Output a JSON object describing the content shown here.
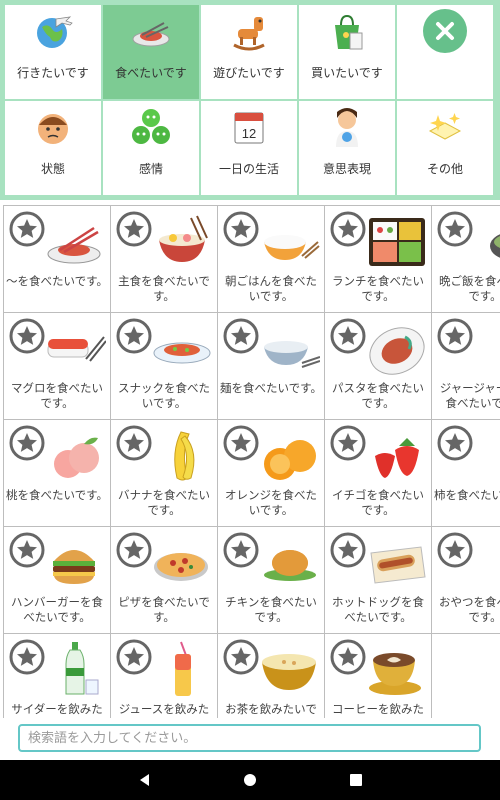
{
  "categories": [
    {
      "label": "行きたいです",
      "icon": "globe-airplane-icon",
      "selected": false
    },
    {
      "label": "食べたいです",
      "icon": "food-plate-icon",
      "selected": true
    },
    {
      "label": "遊びたいです",
      "icon": "rocking-horse-icon",
      "selected": false
    },
    {
      "label": "買いたいです",
      "icon": "shopping-bag-icon",
      "selected": false
    },
    {
      "label": "",
      "icon": "close-icon",
      "selected": false
    },
    {
      "label": "状態",
      "icon": "sick-face-icon",
      "selected": false
    },
    {
      "label": "感情",
      "icon": "emotion-faces-icon",
      "selected": false
    },
    {
      "label": "一日の生活",
      "icon": "calendar-icon",
      "selected": false
    },
    {
      "label": "意思表現",
      "icon": "mother-child-icon",
      "selected": false
    },
    {
      "label": "その他",
      "icon": "sparkle-box-icon",
      "selected": false
    }
  ],
  "calendar_number": "12",
  "items": [
    {
      "label": "～を食べたいです。",
      "icon": "meal-plate-icon"
    },
    {
      "label": "主食を食べたいです。",
      "icon": "rice-bowl-icon"
    },
    {
      "label": "朝ごはんを食べたいです。",
      "icon": "breakfast-bowl-icon"
    },
    {
      "label": "ランチを食べたいです。",
      "icon": "bento-box-icon"
    },
    {
      "label": "晩ご飯を食べたいです。",
      "icon": "dinner-pot-icon"
    },
    {
      "label": "マグロを食べたいです。",
      "icon": "sushi-icon"
    },
    {
      "label": "スナックを食べたいです。",
      "icon": "snack-plate-icon"
    },
    {
      "label": "麺を食べたいです。",
      "icon": "noodle-bowl-icon"
    },
    {
      "label": "パスタを食べたいです。",
      "icon": "pasta-plate-icon"
    },
    {
      "label": "ジャージャー麺を食べたいです。",
      "icon": "jajang-noodle-icon"
    },
    {
      "label": "桃を食べたいです。",
      "icon": "peach-icon"
    },
    {
      "label": "バナナを食べたいです。",
      "icon": "banana-icon"
    },
    {
      "label": "オレンジを食べたいです。",
      "icon": "orange-icon"
    },
    {
      "label": "イチゴを食べたいです。",
      "icon": "strawberry-icon"
    },
    {
      "label": "柿を食べたいです。",
      "icon": "persimmon-icon"
    },
    {
      "label": "ハンバーガーを食べたいです。",
      "icon": "hamburger-icon"
    },
    {
      "label": "ピザを食べたいです。",
      "icon": "pizza-icon"
    },
    {
      "label": "チキンを食べたいです。",
      "icon": "roast-chicken-icon"
    },
    {
      "label": "ホットドッグを食べたいです。",
      "icon": "hotdog-icon"
    },
    {
      "label": "おやつを食べたいです。",
      "icon": "cookies-icon"
    },
    {
      "label": "サイダーを飲みたいです。",
      "icon": "soda-bottle-icon"
    },
    {
      "label": "ジュースを飲みたいです。",
      "icon": "juice-glass-icon"
    },
    {
      "label": "お茶を飲みたいです。",
      "icon": "tea-bowl-icon"
    },
    {
      "label": "コーヒーを飲みたいです。",
      "icon": "coffee-cup-icon"
    }
  ],
  "search": {
    "placeholder": "検索語を入力してください。",
    "value": ""
  },
  "nav": {
    "back": "back-icon",
    "home": "home-icon",
    "recents": "recents-icon"
  },
  "colors": {
    "accent": "#7dcb93",
    "panel": "#a8e2c0",
    "search_border": "#64c7c7",
    "close": "#66c08b"
  }
}
